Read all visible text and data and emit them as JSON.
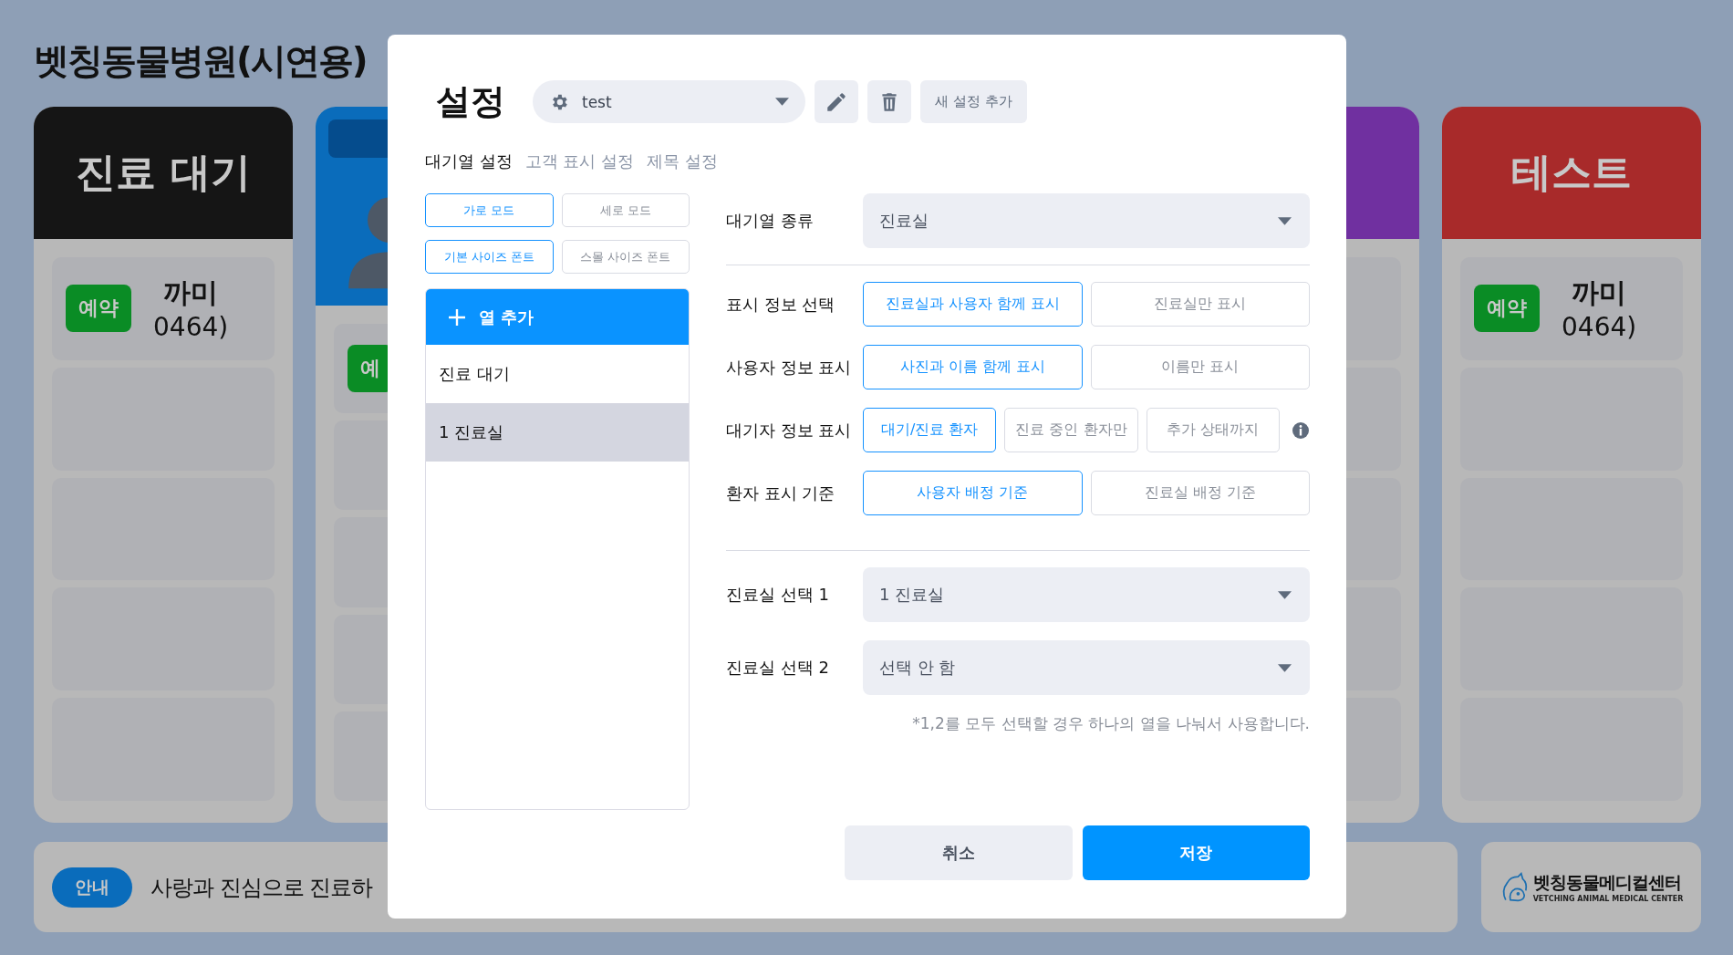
{
  "page": {
    "title": "벳칭동물병원(시연용)"
  },
  "board": {
    "columns": [
      {
        "kind": "title",
        "title": "진료 대기",
        "color": "#151515",
        "cards": [
          {
            "badge": "예약",
            "name": "까미",
            "detail": "0464)"
          }
        ]
      },
      {
        "kind": "photo",
        "color": "#0a6cbb",
        "cards": [
          {
            "badge": "예"
          }
        ]
      },
      {
        "kind": "title",
        "color": "#7030a0"
      },
      {
        "kind": "title",
        "title": "테스트",
        "color": "#a82a2a",
        "cards": [
          {
            "badge": "예약",
            "name": "까미",
            "detail": "0464)"
          }
        ]
      }
    ]
  },
  "notice": {
    "badge": "안내",
    "text": "사랑과 진심으로 진료하"
  },
  "logo": {
    "name": "벳칭동물메디컬센터",
    "subtitle": "VETCHING ANIMAL MEDICAL CENTER"
  },
  "settings_dialog": {
    "title": "설정",
    "preset": "test",
    "add_preset": "새 설정 추가",
    "tabs": [
      {
        "label": "대기열 설정",
        "selected": true
      },
      {
        "label": "고객 표시 설정",
        "selected": false
      },
      {
        "label": "제목 설정",
        "selected": false
      }
    ],
    "mode_buttons": [
      {
        "label": "가로 모드",
        "selected": true
      },
      {
        "label": "세로 모드",
        "selected": false
      }
    ],
    "font_buttons": [
      {
        "label": "기본 사이즈 폰트",
        "selected": true
      },
      {
        "label": "스몰 사이즈 폰트",
        "selected": false
      }
    ],
    "queue_list": {
      "add_label": "열 추가",
      "items": [
        {
          "label": "진료 대기",
          "selected": false
        },
        {
          "label": "1 진료실",
          "selected": true
        }
      ]
    },
    "queue_type": {
      "label": "대기열 종류",
      "value": "진료실"
    },
    "option_groups": [
      {
        "label": "표시 정보 선택",
        "info": false,
        "options": [
          {
            "label": "진료실과 사용자 함께 표시",
            "selected": true
          },
          {
            "label": "진료실만 표시",
            "selected": false
          }
        ]
      },
      {
        "label": "사용자 정보 표시",
        "info": false,
        "options": [
          {
            "label": "사진과 이름 함께 표시",
            "selected": true
          },
          {
            "label": "이름만 표시",
            "selected": false
          }
        ]
      },
      {
        "label": "대기자 정보 표시",
        "info": true,
        "options": [
          {
            "label": "대기/진료 환자",
            "selected": true
          },
          {
            "label": "진료 중인 환자만",
            "selected": false
          },
          {
            "label": "추가 상태까지",
            "selected": false
          }
        ]
      },
      {
        "label": "환자 표시 기준",
        "info": false,
        "options": [
          {
            "label": "사용자 배정 기준",
            "selected": true
          },
          {
            "label": "진료실 배정 기준",
            "selected": false
          }
        ]
      }
    ],
    "room_selects": [
      {
        "label": "진료실 선택 1",
        "value": "1 진료실"
      },
      {
        "label": "진료실 선택 2",
        "value": "선택 안 함"
      }
    ],
    "note": "*1,2를 모두 선택할 경우 하나의 열을 나눠서 사용합니다.",
    "cancel": "취소",
    "save": "저장"
  }
}
